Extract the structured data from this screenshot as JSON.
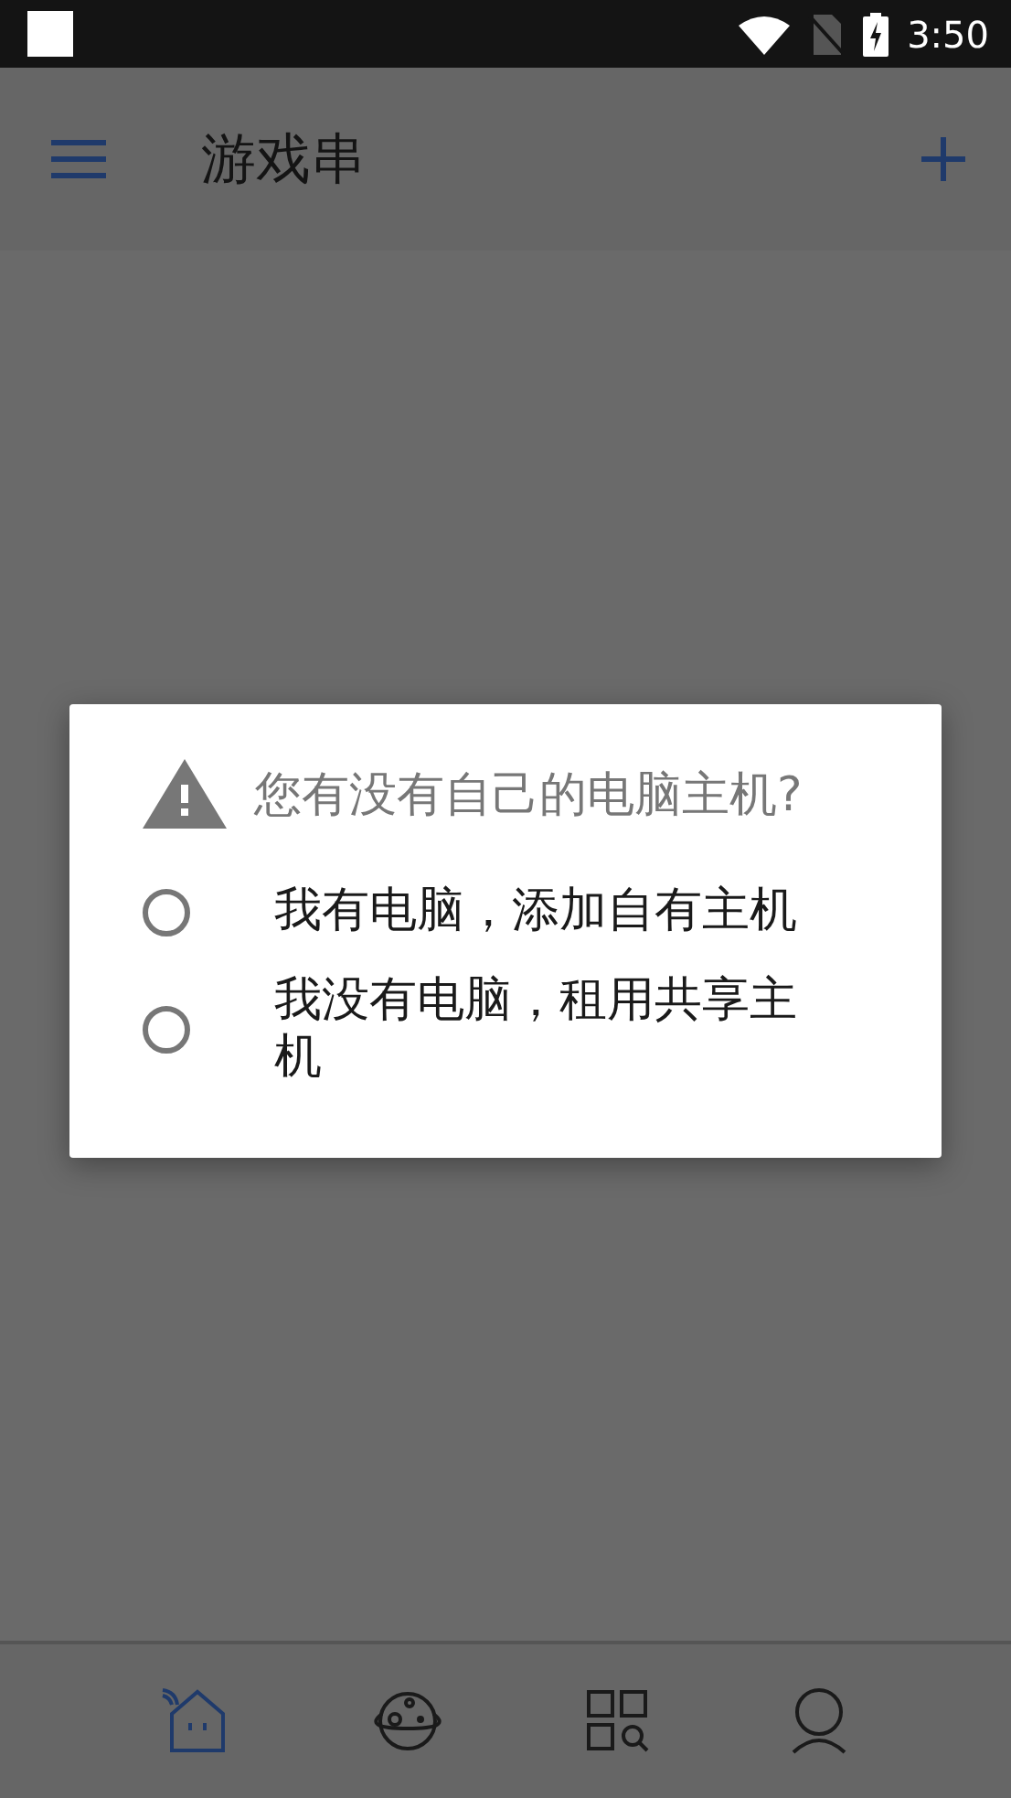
{
  "status_bar": {
    "time": "3:50"
  },
  "app_bar": {
    "title": "游戏串"
  },
  "dialog": {
    "title": "您有没有自己的电脑主机?",
    "options": [
      {
        "label": "我有电脑，添加自有主机",
        "selected": false
      },
      {
        "label": "我没有电脑，租用共享主机",
        "selected": false
      }
    ]
  },
  "bottom_nav": [
    {
      "kind": "home",
      "selected": true
    },
    {
      "kind": "planet",
      "selected": false
    },
    {
      "kind": "apps",
      "selected": false
    },
    {
      "kind": "profile",
      "selected": false
    }
  ]
}
